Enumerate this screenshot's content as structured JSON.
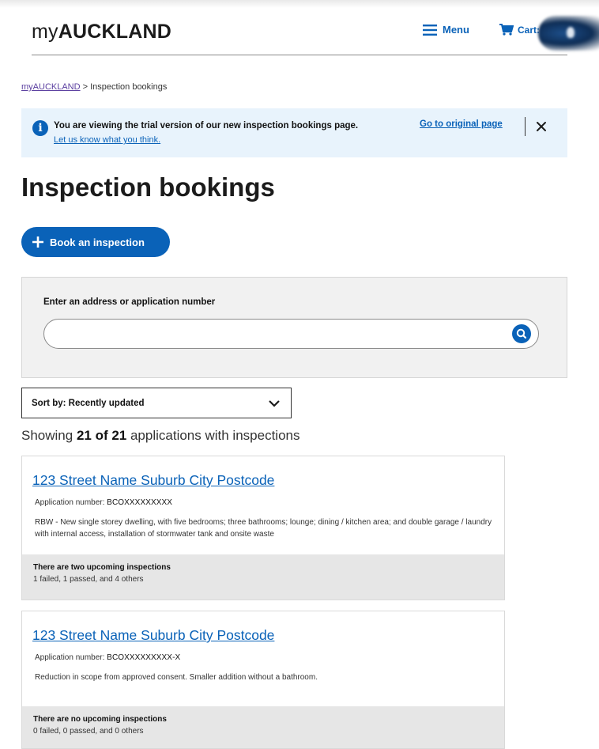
{
  "header": {
    "logo_prefix": "my",
    "logo_bold": "AUCKLAND",
    "menu_label": "Menu",
    "cart_label": "Cart: 0"
  },
  "breadcrumb": {
    "home": "myAUCKLAND",
    "separator": " > ",
    "current": "Inspection bookings"
  },
  "notice": {
    "message": "You are viewing the trial version of our new inspection bookings page.",
    "feedback_link": "Let us know what you think.",
    "original_link": "Go to original page"
  },
  "page_title": "Inspection bookings",
  "book_button": "Book an inspection",
  "search": {
    "label": "Enter an address or application number",
    "value": "",
    "placeholder": ""
  },
  "sort": {
    "selected": "Sort by: Recently updated"
  },
  "results": {
    "prefix": "Showing ",
    "count": "21 of 21",
    "suffix": " applications with inspections"
  },
  "applications": [
    {
      "address": "123 Street Name Suburb City Postcode",
      "number_label": "Application number: ",
      "number": "BCOXXXXXXXXX",
      "description": "RBW - New single storey dwelling, with five bedrooms; three bathrooms; lounge; dining / kitchen area; and double garage / laundry with internal access, installation of stormwater tank and onsite waste",
      "upcoming": "There are two upcoming inspections",
      "summary": "1 failed, 1 passed, and 4 others"
    },
    {
      "address": "123 Street Name Suburb City Postcode",
      "number_label": "Application number: ",
      "number": "BCOXXXXXXXXX-X",
      "description": "Reduction in scope from approved consent. Smaller addition without a bathroom.",
      "upcoming": "There are no upcoming inspections",
      "summary": "0 failed, 0 passed, and 0 others"
    }
  ],
  "colors": {
    "brand_blue": "#0a62b8",
    "notice_bg": "#e8f3fc",
    "panel_bg": "#f1f1f1",
    "card_footer_bg": "#e6e6e6"
  },
  "icons": [
    "menu-icon",
    "cart-icon",
    "info-icon",
    "close-icon",
    "plus-icon",
    "search-icon",
    "chevron-down-icon"
  ]
}
